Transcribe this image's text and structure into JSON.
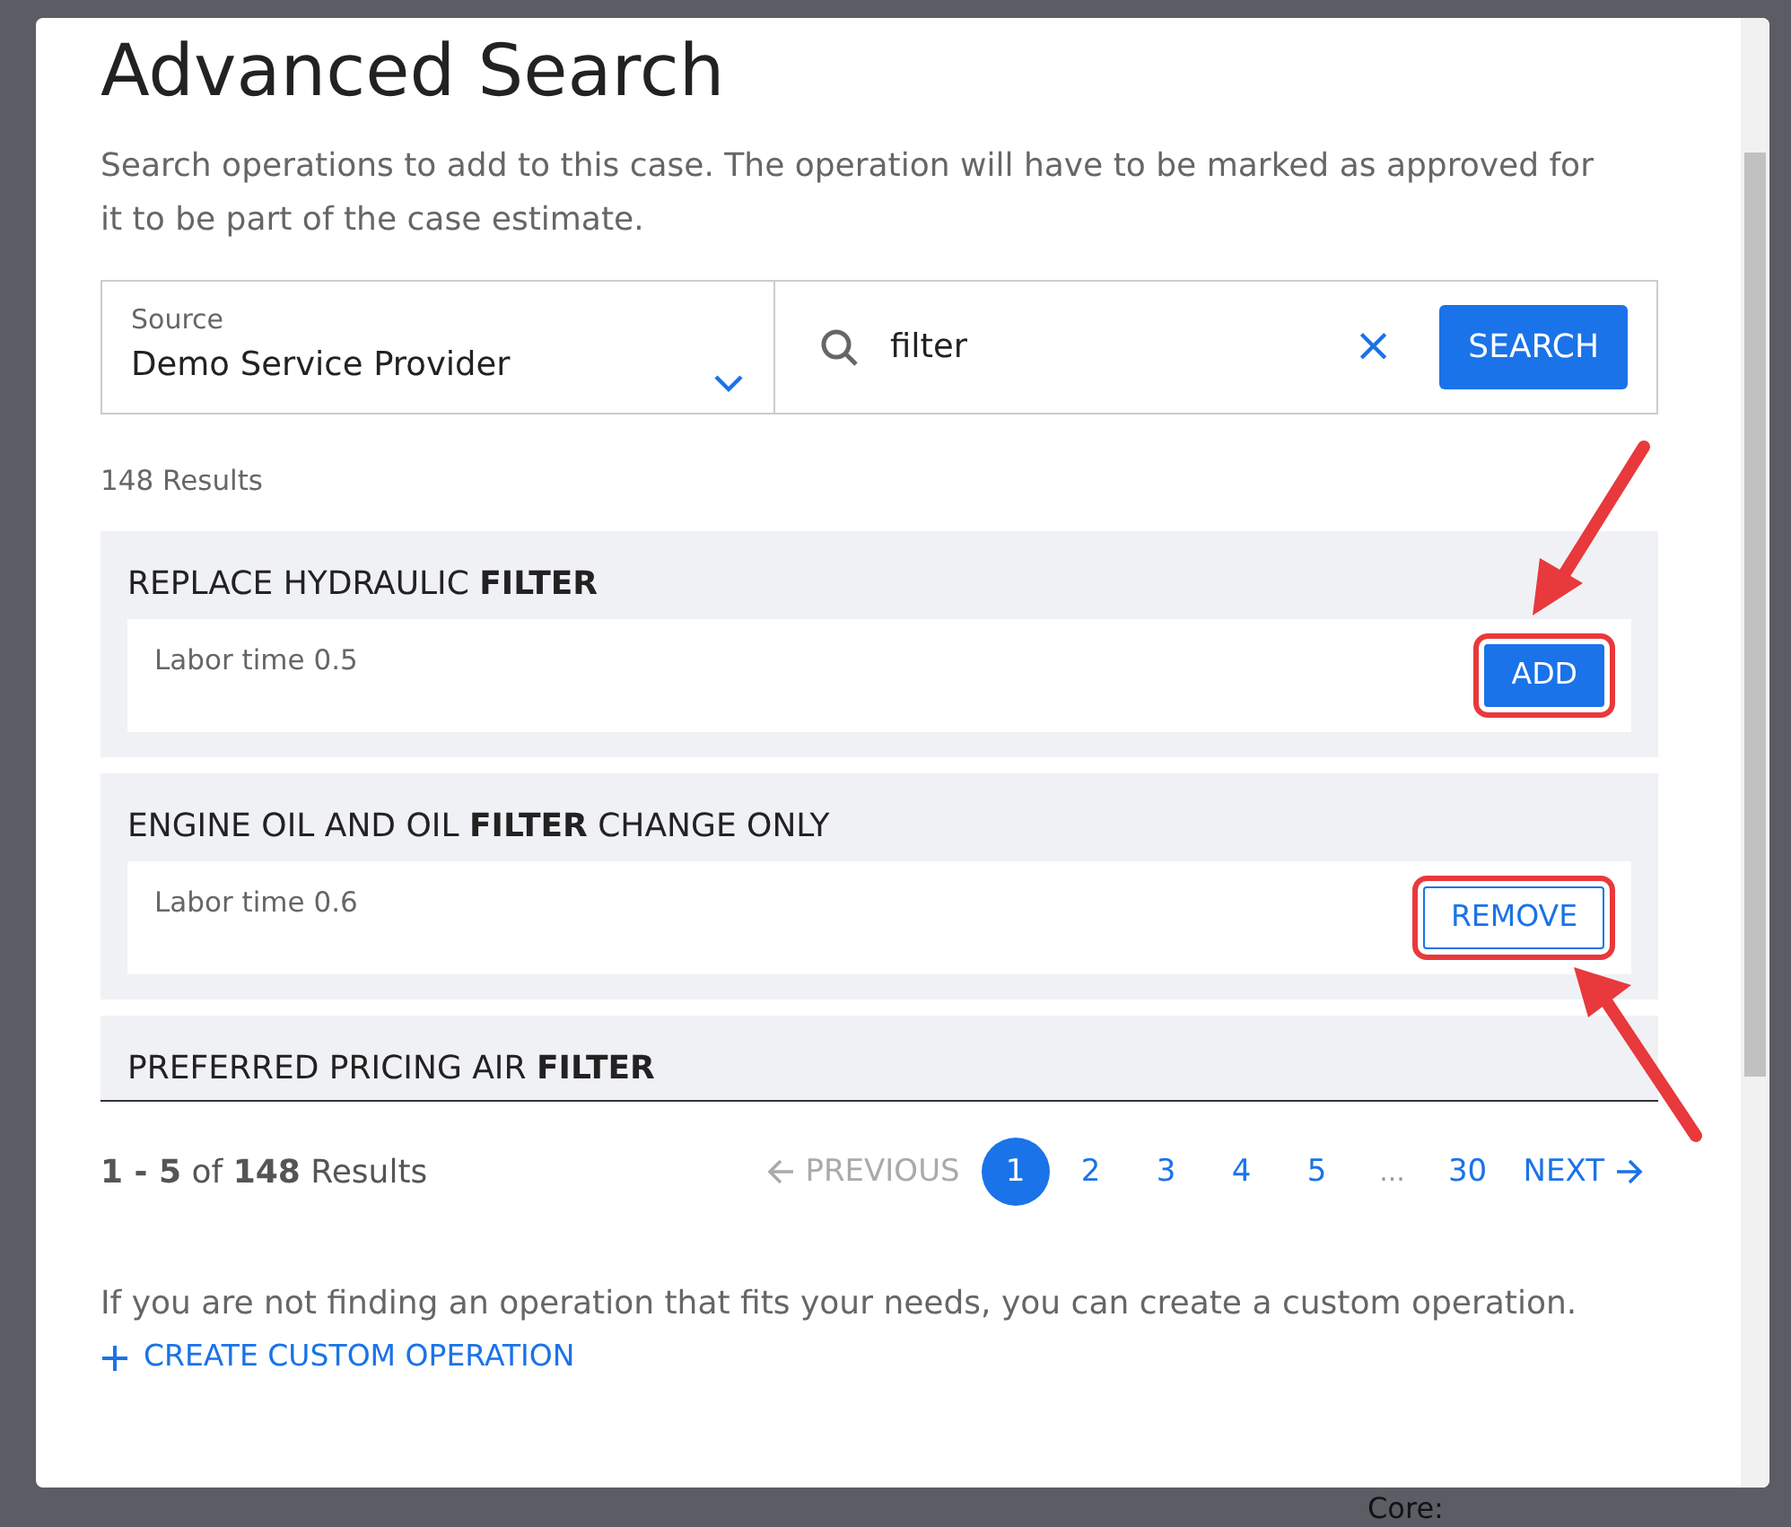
{
  "background": {
    "label": "Core:"
  },
  "modal": {
    "title": "Advanced Search",
    "description": "Search operations to add to this case. The operation will have to be marked as approved for it to be part of the case estimate."
  },
  "source": {
    "label": "Source",
    "value": "Demo Service Provider"
  },
  "search": {
    "value": "filter",
    "clear": "×",
    "button": "SEARCH"
  },
  "result_count": "148 Results",
  "results": [
    {
      "title": "REPLACE HYDRAULIC **FILTER**",
      "labor": "Labor time 0.5",
      "kind": "add",
      "button": "ADD",
      "highlighted": true
    },
    {
      "title": "ENGINE OIL AND OIL **FILTER** CHANGE ONLY",
      "labor": "Labor time 0.6",
      "kind": "remove",
      "button": "REMOVE",
      "highlighted": true
    },
    {
      "title": "PREFERRED PRICING AIR **FILTER**"
    }
  ],
  "pagination": {
    "summary": "**1 - 5** of **148** Results",
    "previous": "PREVIOUS",
    "previous_disabled": true,
    "next": "NEXT",
    "pages": [
      {
        "label": "1",
        "selected": true
      },
      {
        "label": "2",
        "selected": false
      },
      {
        "label": "3",
        "selected": false
      },
      {
        "label": "4",
        "selected": false
      },
      {
        "label": "5",
        "selected": false
      },
      {
        "label": "...",
        "kind": "gap"
      },
      {
        "label": "30",
        "selected": false
      }
    ]
  },
  "footer": {
    "note": "If you are not finding an operation that fits your needs, you can create a custom operation.",
    "create": "CREATE CUSTOM OPERATION"
  }
}
